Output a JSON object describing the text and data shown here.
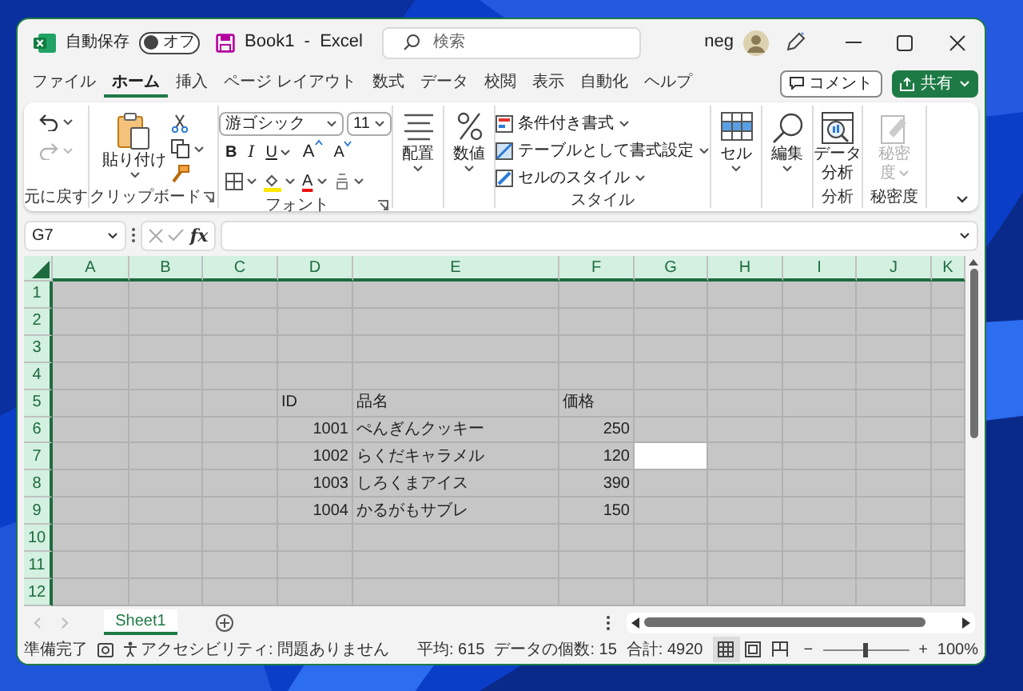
{
  "title_bar": {
    "autosave_label": "自動保存",
    "autosave": {
      "on": false,
      "label": "オフ"
    },
    "title": "Book1  -  Excel",
    "search": {
      "placeholder": "検索"
    },
    "user": "neg"
  },
  "menu_tabs": [
    {
      "label": "ファイル",
      "selected": false
    },
    {
      "label": "ホーム",
      "selected": true
    },
    {
      "label": "挿入",
      "selected": false
    },
    {
      "label": "ページ レイアウト",
      "selected": false
    },
    {
      "label": "数式",
      "selected": false
    },
    {
      "label": "データ",
      "selected": false
    },
    {
      "label": "校閲",
      "selected": false
    },
    {
      "label": "表示",
      "selected": false
    },
    {
      "label": "自動化",
      "selected": false
    },
    {
      "label": "ヘルプ",
      "selected": false
    }
  ],
  "comment_button": "コメント",
  "share_button": "共有",
  "ribbon": {
    "undo": {
      "label": "元に戻す",
      "redo_disabled": true
    },
    "clipboard": {
      "paste": "貼り付け",
      "label": "クリップボード"
    },
    "font": {
      "name": "游ゴシック",
      "size": "11",
      "bold": "B",
      "italic": "I",
      "underline": "U",
      "grow": "A",
      "shrink": "A",
      "font_color": "A",
      "label": "フォント"
    },
    "alignment": "配置",
    "number": "数値",
    "styles": {
      "items": [
        "条件付き書式",
        "テーブルとして書式設定",
        "セルのスタイル"
      ],
      "label": "スタイル"
    },
    "cells": "セル",
    "editing": "編集",
    "analysis": {
      "button": [
        "データ",
        "分析"
      ],
      "label": "分析"
    },
    "sensitivity": {
      "button": [
        "秘密",
        "度"
      ],
      "disabled": true,
      "label": "秘密度"
    }
  },
  "formula_bar": {
    "name_box": "G7",
    "fx": "fx"
  },
  "sheet": {
    "all_selected": true,
    "columns": [
      "A",
      "B",
      "C",
      "D",
      "E",
      "F",
      "G",
      "H",
      "I",
      "J",
      "K"
    ],
    "rows": [
      {
        "header": "1"
      },
      {
        "header": "2"
      },
      {
        "header": "3"
      },
      {
        "header": "4"
      },
      {
        "header": "5",
        "cells": [
          null,
          null,
          null,
          {
            "text": "ID",
            "kind": "text",
            "active": false
          },
          {
            "text": "品名",
            "kind": "text",
            "active": false
          },
          {
            "text": "価格",
            "kind": "text",
            "active": false
          }
        ]
      },
      {
        "header": "6",
        "cells": [
          null,
          null,
          null,
          {
            "text": "1001",
            "kind": "number",
            "active": false
          },
          {
            "text": "ぺんぎんクッキー",
            "kind": "text",
            "active": false
          },
          {
            "text": "250",
            "kind": "number",
            "active": false
          }
        ]
      },
      {
        "header": "7",
        "cells": [
          null,
          null,
          null,
          {
            "text": "1002",
            "kind": "number",
            "active": false
          },
          {
            "text": "らくだキャラメル",
            "kind": "text",
            "active": false
          },
          {
            "text": "120",
            "kind": "number",
            "active": false
          },
          {
            "active": true
          }
        ]
      },
      {
        "header": "8",
        "cells": [
          null,
          null,
          null,
          {
            "text": "1003",
            "kind": "number",
            "active": false
          },
          {
            "text": "しろくまアイス",
            "kind": "text",
            "active": false
          },
          {
            "text": "390",
            "kind": "number",
            "active": false
          }
        ]
      },
      {
        "header": "9",
        "cells": [
          null,
          null,
          null,
          {
            "text": "1004",
            "kind": "number",
            "active": false
          },
          {
            "text": "かるがもサブレ",
            "kind": "text",
            "active": false
          },
          {
            "text": "150",
            "kind": "number",
            "active": false
          }
        ]
      },
      {
        "header": "10"
      },
      {
        "header": "11"
      },
      {
        "header": "12"
      }
    ]
  },
  "sheet_tabs": [
    {
      "label": "Sheet1",
      "selected": true
    }
  ],
  "status_bar": {
    "ready": "準備完了",
    "accessibility": "アクセシビリティ: 問題ありません",
    "average": "平均: 615",
    "count": "データの個数: 15",
    "sum": "合計: 4920",
    "views": [
      {
        "kind": "normal",
        "selected": true
      },
      {
        "kind": "page_layout",
        "selected": false
      },
      {
        "kind": "page_break",
        "selected": false
      }
    ],
    "zoom_out": "−",
    "zoom_in": "+",
    "zoom_slider": {
      "level": 0.5
    },
    "zoom": "100%"
  }
}
